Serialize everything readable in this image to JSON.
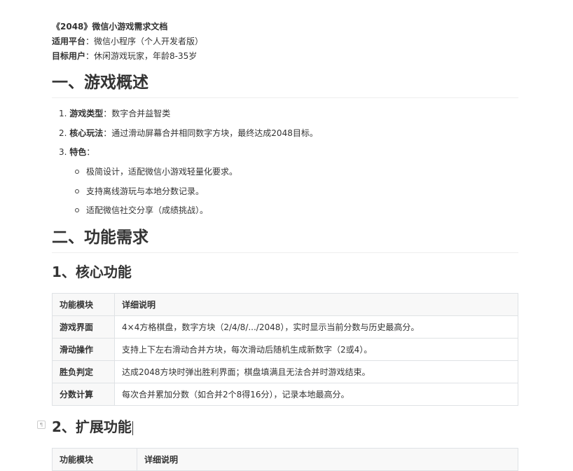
{
  "doc": {
    "title": "《2048》微信小游戏需求文档",
    "platform_label": "适用平台",
    "platform_value": "：微信小程序（个人开发者版）",
    "users_label": "目标用户",
    "users_value": "：休闲游戏玩家，年龄8-35岁"
  },
  "section1": {
    "heading": "一、游戏概述",
    "items": [
      {
        "num": "1.",
        "label": "游戏类型",
        "text": "：数字合并益智类"
      },
      {
        "num": "2.",
        "label": "核心玩法",
        "text": "：通过滑动屏幕合并相同数字方块，最终达成2048目标。"
      },
      {
        "num": "3.",
        "label": "特色",
        "text": "："
      }
    ],
    "features": [
      "极简设计，适配微信小游戏轻量化要求。",
      "支持离线游玩与本地分数记录。",
      "适配微信社交分享（成绩挑战）。"
    ]
  },
  "section2": {
    "heading": "二、功能需求",
    "sub1": {
      "heading": "1、核心功能",
      "headers": [
        "功能模块",
        "详细说明"
      ],
      "rows": [
        {
          "module": "游戏界面",
          "desc": "4×4方格棋盘，数字方块（2/4/8/.../2048），实时显示当前分数与历史最高分。"
        },
        {
          "module": "滑动操作",
          "desc": "支持上下左右滑动合并方块，每次滑动后随机生成新数字（2或4）。"
        },
        {
          "module": "胜负判定",
          "desc": "达成2048方块时弹出胜利界面；棋盘填满且无法合并时游戏结束。"
        },
        {
          "module": "分数计算",
          "desc": "每次合并累加分数（如合并2个8得16分），记录本地最高分。"
        }
      ]
    },
    "sub2": {
      "heading": "2、扩展功能",
      "headers": [
        "功能模块",
        "详细说明"
      ]
    }
  }
}
